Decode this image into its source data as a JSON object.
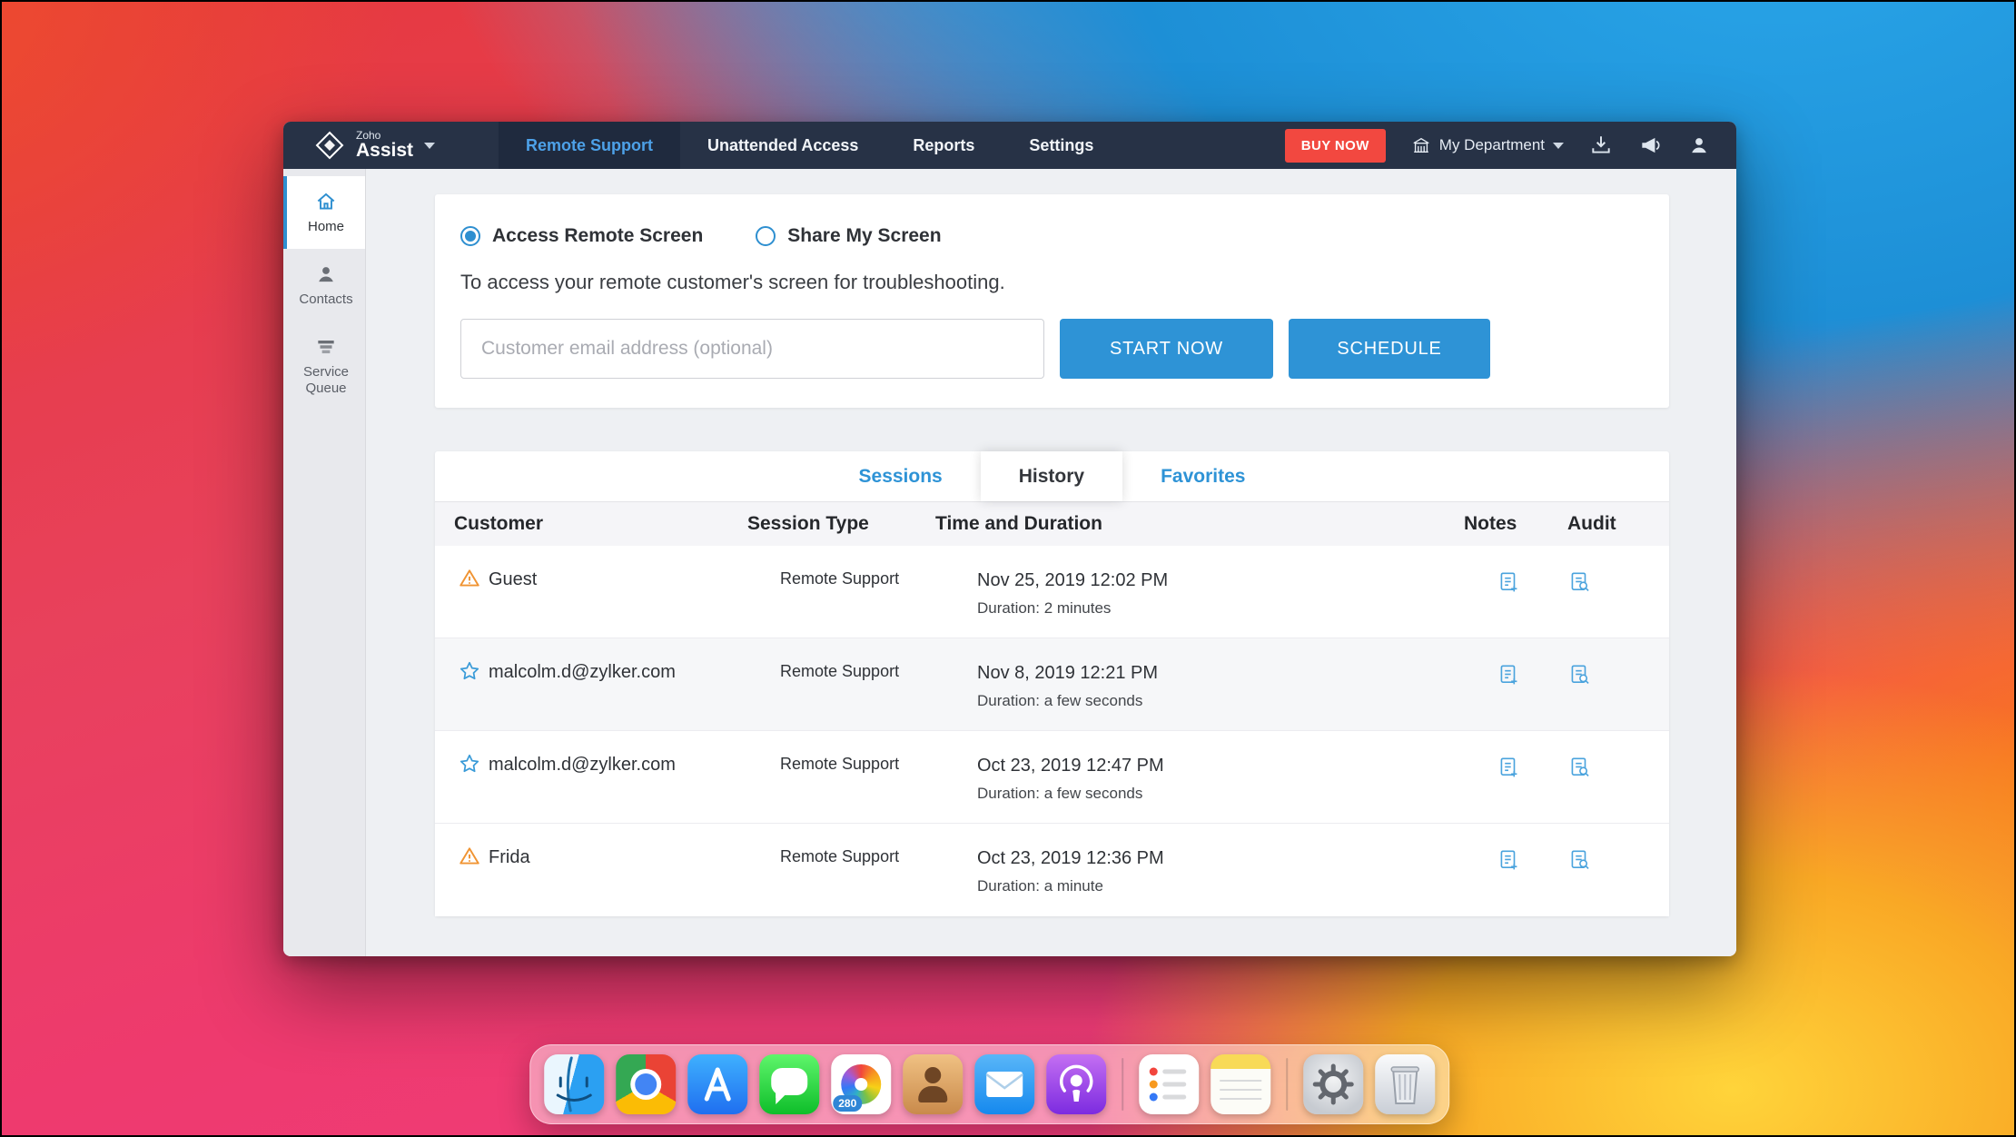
{
  "colors": {
    "accent_blue": "#2e93d6",
    "navbar_bg": "#273246",
    "buy_now_red": "#f24840",
    "warning_orange": "#f09433",
    "link_blue": "#2e93d6"
  },
  "window": {
    "navbar": {
      "brand_small": "Zoho",
      "brand_large": "Assist",
      "tabs": [
        {
          "label": "Remote Support",
          "active": true
        },
        {
          "label": "Unattended Access",
          "active": false
        },
        {
          "label": "Reports",
          "active": false
        },
        {
          "label": "Settings",
          "active": false
        }
      ],
      "buy_now_label": "BUY NOW",
      "department_label": "My Department"
    },
    "sidebar": {
      "items": [
        {
          "label": "Home",
          "icon": "home",
          "active": true
        },
        {
          "label": "Contacts",
          "icon": "contacts",
          "active": false
        },
        {
          "label": "Service Queue",
          "icon": "service-queue",
          "active": false
        }
      ]
    },
    "session_panel": {
      "options": [
        {
          "label": "Access Remote Screen",
          "selected": true
        },
        {
          "label": "Share My Screen",
          "selected": false
        }
      ],
      "description": "To access your remote customer's screen for troubleshooting.",
      "email_placeholder": "Customer email address (optional)",
      "start_label": "START NOW",
      "schedule_label": "SCHEDULE"
    },
    "history_panel": {
      "tabs": [
        {
          "label": "Sessions",
          "active": false
        },
        {
          "label": "History",
          "active": true
        },
        {
          "label": "Favorites",
          "active": false
        }
      ],
      "headers": {
        "customer": "Customer",
        "session_type": "Session Type",
        "time": "Time and Duration",
        "notes": "Notes",
        "audit": "Audit"
      },
      "rows": [
        {
          "icon": "warning",
          "customer": "Guest",
          "session_type": "Remote Support",
          "time": "Nov 25, 2019 12:02 PM",
          "duration": "Duration: 2 minutes"
        },
        {
          "icon": "star",
          "customer": "malcolm.d@zylker.com",
          "session_type": "Remote Support",
          "time": "Nov 8, 2019 12:21 PM",
          "duration": "Duration: a few seconds"
        },
        {
          "icon": "star",
          "customer": "malcolm.d@zylker.com",
          "session_type": "Remote Support",
          "time": "Oct 23, 2019 12:47 PM",
          "duration": "Duration: a few seconds"
        },
        {
          "icon": "warning",
          "customer": "Frida",
          "session_type": "Remote Support",
          "time": "Oct 23, 2019 12:36 PM",
          "duration": "Duration: a minute"
        }
      ]
    }
  },
  "dock": {
    "badge": "280",
    "items": [
      "finder",
      "chrome",
      "app-store",
      "messages",
      "photos",
      "contacts",
      "mail",
      "podcasts",
      "reminders",
      "notes",
      "system-preferences",
      "trash"
    ]
  }
}
